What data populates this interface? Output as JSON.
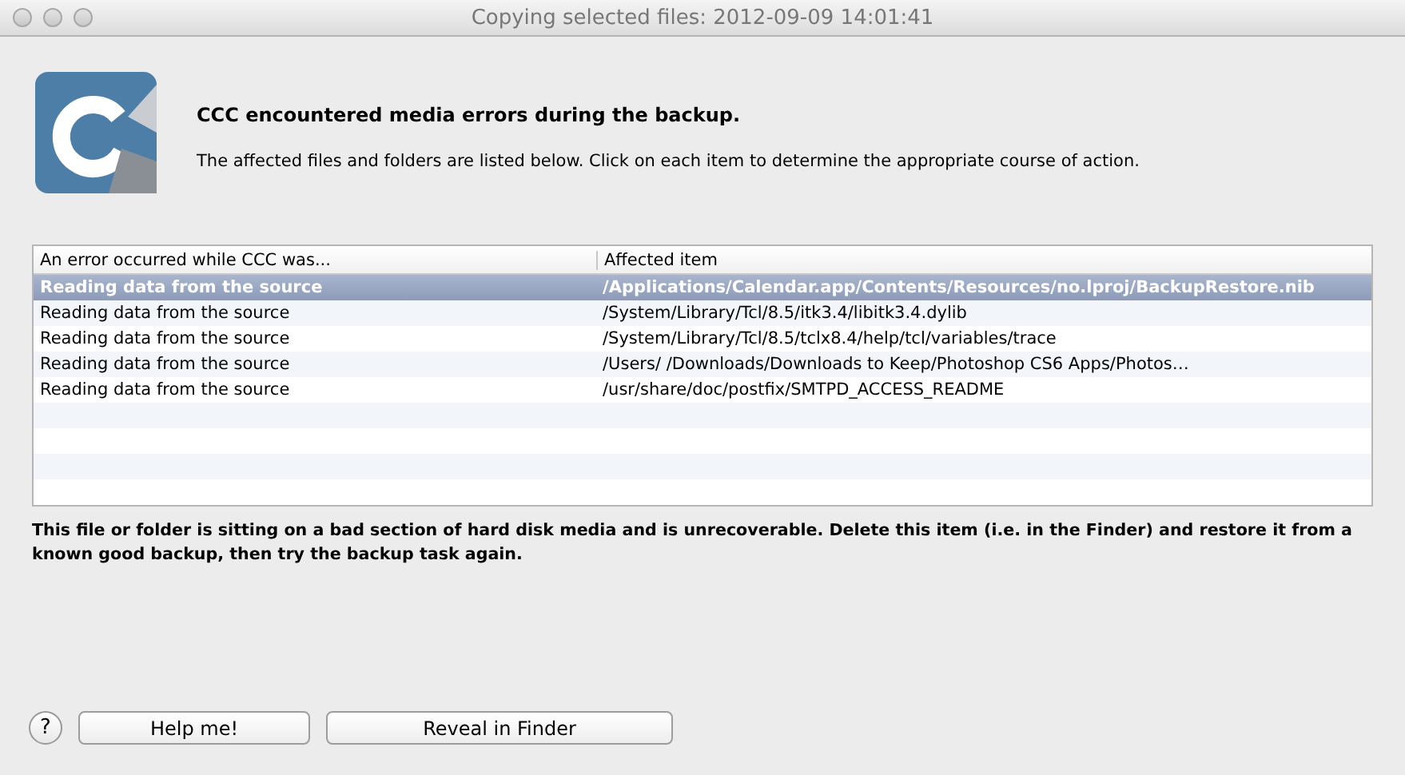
{
  "window": {
    "title": "Copying selected files: 2012-09-09 14:01:41"
  },
  "heading": "CCC encountered media errors during the backup.",
  "subtext": "The affected files and folders are listed below. Click on each item to determine the appropriate course of action.",
  "table": {
    "columns": [
      "An error occurred while CCC was...",
      "Affected item"
    ],
    "rows": [
      {
        "error": "Reading data from the source",
        "item": "/Applications/Calendar.app/Contents/Resources/no.lproj/BackupRestore.nib",
        "selected": true
      },
      {
        "error": "Reading data from the source",
        "item": "/System/Library/Tcl/8.5/itk3.4/libitk3.4.dylib",
        "selected": false
      },
      {
        "error": "Reading data from the source",
        "item": "/System/Library/Tcl/8.5/tclx8.4/help/tcl/variables/trace",
        "selected": false
      },
      {
        "error": "Reading data from the source",
        "item": "/Users/ /Downloads/Downloads to Keep/Photoshop CS6 Apps/Photos…",
        "selected": false
      },
      {
        "error": "Reading data from the source",
        "item": "/usr/share/doc/postfix/SMTPD_ACCESS_README",
        "selected": false
      }
    ]
  },
  "description": "This file or folder is sitting on a bad section of hard disk media and is unrecoverable. Delete this item (i.e. in the Finder) and restore it from a known good backup, then try the backup task again.",
  "help_glyph": "?",
  "buttons": [
    "Help me!",
    "Reveal in Finder"
  ]
}
